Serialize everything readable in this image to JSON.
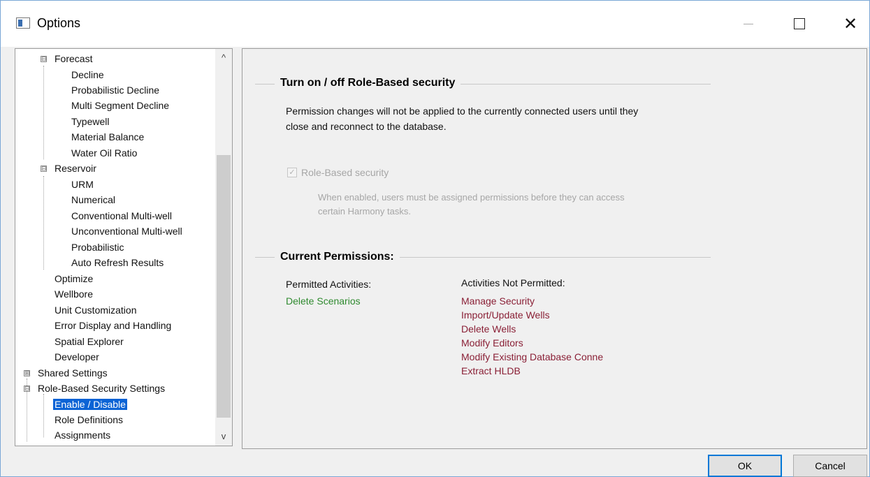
{
  "window": {
    "title": "Options",
    "minimize_icon": "minimize-icon",
    "maximize_icon": "maximize-icon",
    "close_glyph": "✕"
  },
  "tree": {
    "items": [
      {
        "label": "Forecast",
        "expander": "⊟"
      },
      {
        "label": "Decline"
      },
      {
        "label": "Probabilistic Decline"
      },
      {
        "label": "Multi Segment Decline"
      },
      {
        "label": "Typewell"
      },
      {
        "label": "Material Balance"
      },
      {
        "label": "Water Oil Ratio"
      },
      {
        "label": "Reservoir",
        "expander": "⊟"
      },
      {
        "label": "URM"
      },
      {
        "label": "Numerical"
      },
      {
        "label": "Conventional Multi-well"
      },
      {
        "label": "Unconventional Multi-well"
      },
      {
        "label": "Probabilistic"
      },
      {
        "label": "Auto Refresh Results"
      },
      {
        "label": "Optimize"
      },
      {
        "label": "Wellbore"
      },
      {
        "label": "Unit Customization"
      },
      {
        "label": "Error Display and Handling"
      },
      {
        "label": "Spatial Explorer"
      },
      {
        "label": "Developer"
      },
      {
        "label": "Shared Settings",
        "expander": "⊞"
      },
      {
        "label": "Role-Based Security Settings",
        "expander": "⊟"
      },
      {
        "label": "Enable / Disable",
        "selected": true
      },
      {
        "label": "Role Definitions"
      },
      {
        "label": "Assignments"
      }
    ],
    "scroll_up": "^",
    "scroll_down": "v"
  },
  "panel": {
    "section1_title": "Turn on / off Role-Based security",
    "section1_text_line1": "Permission changes will not be applied to the currently connected users until they",
    "section1_text_line2": "close and reconnect to the database.",
    "checkbox_label": "Role-Based security",
    "checkbox_checked": true,
    "checkbox_help_line1": "When enabled, users must be assigned permissions before they can access",
    "checkbox_help_line2": "certain Harmony tasks.",
    "section2_title": "Current Permissions:",
    "permitted_header": "Permitted Activities:",
    "permitted": [
      "Delete Scenarios"
    ],
    "not_permitted_header": "Activities Not Permitted:",
    "not_permitted": [
      "Manage Security",
      "Import/Update Wells",
      "Delete Wells",
      "Modify Editors",
      "Modify Existing Database Conne",
      "Extract HLDB"
    ]
  },
  "buttons": {
    "ok": "OK",
    "cancel": "Cancel"
  },
  "colors": {
    "selection": "#0b63d5",
    "permitted": "#2f8a2f",
    "not_permitted": "#8a2036",
    "ok_border": "#0078d7"
  }
}
